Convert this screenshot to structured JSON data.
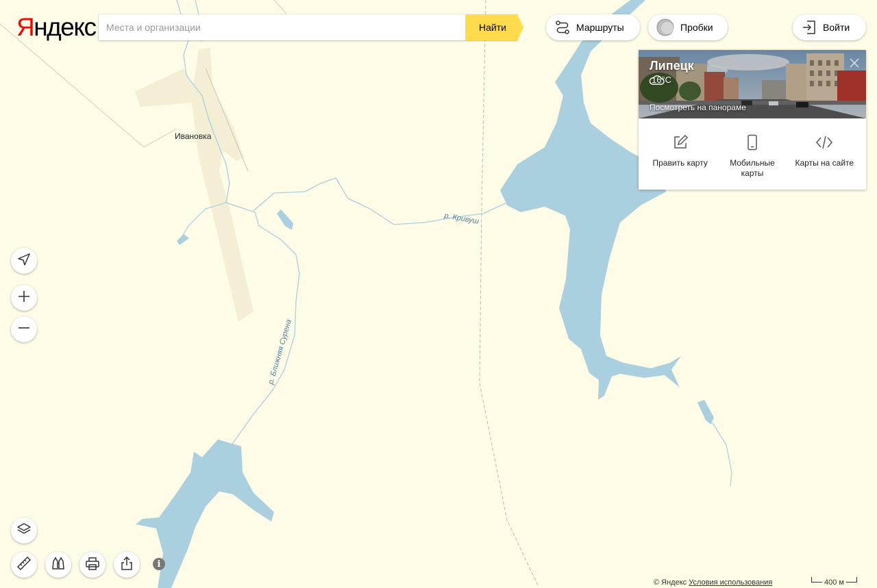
{
  "logo": {
    "first_letter": "Я",
    "rest": "ндекс"
  },
  "search": {
    "placeholder": "Места и организации",
    "button_label": "Найти"
  },
  "header_buttons": {
    "routes": "Маршруты",
    "traffic": "Пробки",
    "login": "Войти"
  },
  "info_card": {
    "city": "Липецк",
    "temperature": "16°C",
    "weather_icon": "cloud-icon",
    "panorama_link": "Посмотреть на панораме",
    "actions": [
      {
        "label": "Править карту",
        "icon": "pencil-icon"
      },
      {
        "label": "Мобильные карты",
        "icon": "phone-icon"
      },
      {
        "label": "Карты на сайте",
        "icon": "code-icon"
      }
    ]
  },
  "map": {
    "place_labels": [
      "Ивановка"
    ],
    "river_labels": [
      "р. Кривуш",
      "р. Ближняя Сурена"
    ]
  },
  "controls": {
    "left": [
      "geolocation-icon",
      "zoom-in-icon",
      "zoom-out-icon",
      "layers-icon"
    ],
    "bottom": [
      "ruler-icon",
      "panorama-icon",
      "print-icon",
      "share-icon",
      "info-icon"
    ]
  },
  "info_symbol": "i",
  "footer": {
    "copyright": "© Яндекс",
    "terms_link": "Условия использования",
    "scale_label": "400 м"
  },
  "colors": {
    "land": "#fefce6",
    "water": "#aacfdf",
    "settlement": "#f4efd6",
    "accent": "#ffdb4d"
  }
}
